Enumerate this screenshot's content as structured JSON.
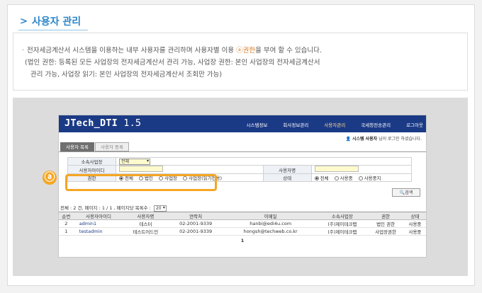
{
  "page": {
    "title": "사용자 관리",
    "title_prefix": ">",
    "notice": {
      "line1_pre": "전자세금계산서 시스템을 이용하는 내부 사용자를 관리하며 사용자별 이용 ",
      "line1_accent": "ⓐ권한",
      "line1_post": "을 부여 할 수 있습니다.",
      "line2": "(법인 권한: 등록된 모든 사업장의 전자세금계산서 관리 가능, 사업장 권한: 본인 사업장의 전자세금계산서",
      "line3": "관리 가능, 사업장 읽기: 본인 사업장의 전자세금계산서 조회만 가능)"
    },
    "callout_marker": "ⓐ"
  },
  "shot": {
    "brand": "JTech_DTI",
    "version": " 1.5",
    "nav": [
      {
        "label": "시스템정보",
        "active": false
      },
      {
        "label": "회사정보관리",
        "active": false
      },
      {
        "label": "사용자관리",
        "active": true
      },
      {
        "label": "국세청전송관리",
        "active": false
      },
      {
        "label": "로그아웃",
        "active": false
      }
    ],
    "user_role": "시스템 사용자",
    "user_suffix": " 님이 로그인 하셨습니다.",
    "tabs": [
      "사용자 목록",
      "사용자 등록"
    ],
    "form": {
      "site_label": "소속사업장",
      "site_value": "전체",
      "userid_label": "사용자아이디",
      "username_label": "사용자명",
      "perm_label": "권한",
      "perm_options": [
        "전체",
        "법인",
        "사업장",
        "사업장(읽기전용)"
      ],
      "status_label": "상태",
      "status_options": [
        "전체",
        "사용중",
        "사용중지"
      ]
    },
    "search_button": "검색",
    "summary": "전체 : 2 건, 페이지 : 1 / 1 , 페이지당 목록수 :",
    "page_size": "20",
    "columns": [
      "순번",
      "사용자아이디",
      "사용자명",
      "연락처",
      "이메일",
      "소속사업장",
      "권한",
      "상태"
    ],
    "rows": [
      [
        "2",
        "admin1",
        "테스터",
        "02-2001-9339",
        "hanbi@edi4u.com",
        "(주)제이테크랩",
        "법인 권한",
        "사용중"
      ],
      [
        "1",
        "testadmin",
        "테스트어드민",
        "02-2001-9339",
        "hongsh@techweb.co.kr",
        "(주)제이테크랩",
        "사업장권한",
        "사용중"
      ]
    ],
    "pager": "1"
  },
  "colors": {
    "accent_blue": "#2b86c8",
    "nav_bg": "#1b3a86",
    "highlight_orange": "#f5a623"
  }
}
